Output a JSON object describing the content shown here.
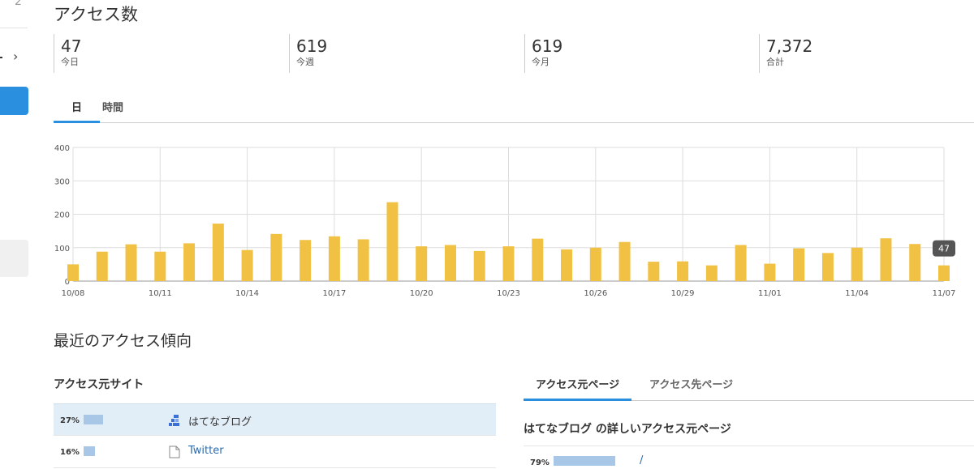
{
  "sidebar_fragment": {
    "top_text": "2",
    "chevron": "›"
  },
  "title": "アクセス数",
  "stats": [
    {
      "value": "47",
      "label": "今日"
    },
    {
      "value": "619",
      "label": "今週"
    },
    {
      "value": "619",
      "label": "今月"
    },
    {
      "value": "7,372",
      "label": "合計"
    }
  ],
  "tabs": [
    {
      "label": "日",
      "active": true
    },
    {
      "label": "時間",
      "active": false
    }
  ],
  "chart_data": {
    "type": "bar",
    "categories": [
      "10/08",
      "10/09",
      "10/10",
      "10/11",
      "10/12",
      "10/13",
      "10/14",
      "10/15",
      "10/16",
      "10/17",
      "10/18",
      "10/19",
      "10/20",
      "10/21",
      "10/22",
      "10/23",
      "10/24",
      "10/25",
      "10/26",
      "10/27",
      "10/28",
      "10/29",
      "10/30",
      "10/31",
      "11/01",
      "11/02",
      "11/03",
      "11/04",
      "11/05",
      "11/06",
      "11/07"
    ],
    "values": [
      50,
      88,
      110,
      88,
      113,
      172,
      93,
      141,
      123,
      134,
      125,
      236,
      104,
      108,
      90,
      104,
      127,
      95,
      100,
      117,
      58,
      59,
      47,
      108,
      52,
      98,
      84,
      100,
      128,
      111,
      47
    ],
    "x_tick_labels": [
      "10/08",
      "10/11",
      "10/14",
      "10/17",
      "10/20",
      "10/23",
      "10/26",
      "10/29",
      "11/01",
      "11/04",
      "11/07"
    ],
    "y_tick_labels": [
      "0",
      "100",
      "200",
      "300",
      "400"
    ],
    "ylim": [
      0,
      400
    ],
    "grid": true,
    "bar_color": "#f0c143",
    "tooltip": {
      "label": "47",
      "category": "11/07"
    }
  },
  "trend_title": "最近のアクセス傾向",
  "referrers": {
    "heading": "アクセス元サイト",
    "rows": [
      {
        "percent_label": "27%",
        "percent": 27,
        "name": "はてなブログ",
        "icon": "hatena-blog-icon",
        "highlighted": true
      },
      {
        "percent_label": "16%",
        "percent": 16,
        "name": "Twitter",
        "icon": "document-icon",
        "highlighted": false
      }
    ]
  },
  "right_panel": {
    "tabs": [
      {
        "label": "アクセス元ページ",
        "active": true
      },
      {
        "label": "アクセス先ページ",
        "active": false
      }
    ],
    "subtitle": "はてなブログ の詳しいアクセス元ページ",
    "rows": [
      {
        "percent_label": "79%",
        "percent": 79,
        "path": "/"
      }
    ]
  },
  "colors": {
    "accent": "#2b8fe0",
    "bar": "#f0c143",
    "ratio_bar": "#a8c6e5",
    "highlight_row": "#e2eef7"
  }
}
